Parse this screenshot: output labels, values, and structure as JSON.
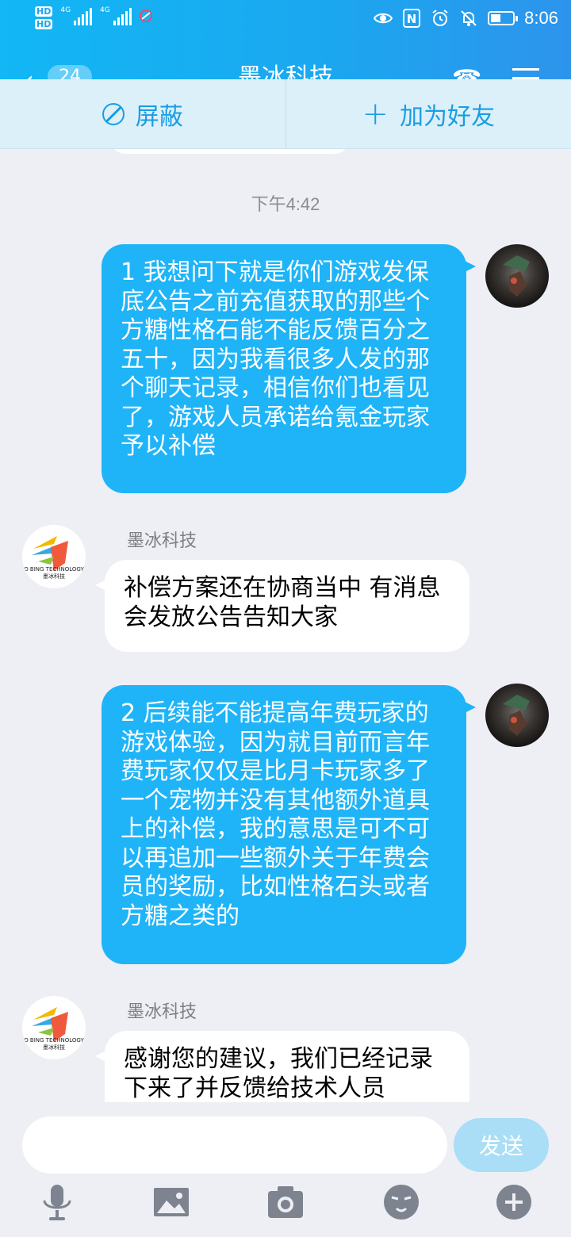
{
  "status_bar": {
    "hd1": "HD",
    "hd2": "HD",
    "net1": "4G",
    "net2": "4G",
    "nfc": "N",
    "time": "8:06"
  },
  "header": {
    "back_badge": "24",
    "title": "墨冰科技"
  },
  "stranger_bar": {
    "block_label": "屏蔽",
    "add_friend_label": "加为好友"
  },
  "chat": {
    "timestamp": "下午4:42",
    "messages": [
      {
        "side": "out",
        "text": "1 我想问下就是你们游戏发保底公告之前充值获取的那些个方糖性格石能不能反馈百分之五十，因为我看很多人发的那个聊天记录，相信你们也看见了，游戏人员承诺给氪金玩家予以补偿"
      },
      {
        "side": "in",
        "sender": "墨冰科技",
        "text": "补偿方案还在协商当中 有消息会发放公告告知大家"
      },
      {
        "side": "out",
        "text": "2 后续能不能提高年费玩家的游戏体验，因为就目前而言年费玩家仅仅是比月卡玩家多了一个宠物并没有其他额外道具上的补偿，我的意思是可不可以再追加一些额外关于年费会员的奖励，比如性格石头或者方糖之类的"
      },
      {
        "side": "in",
        "sender": "墨冰科技",
        "text": "感谢您的建议，我们已经记录下来了并反馈给技术人员"
      }
    ],
    "corp_avatar_text": "O BING TECHNOLOGY\n墨冰科技"
  },
  "input": {
    "value": "",
    "send_label": "发送"
  },
  "toolbar": {
    "icons": [
      "microphone-icon",
      "image-icon",
      "camera-icon",
      "emoji-icon",
      "plus-circle-icon"
    ]
  },
  "colors": {
    "header": "#12b7f5",
    "outgoing_bubble": "#1fb4f8",
    "incoming_bubble": "#ffffff",
    "accent": "#1a9de2",
    "send_disabled": "#a9def6"
  }
}
